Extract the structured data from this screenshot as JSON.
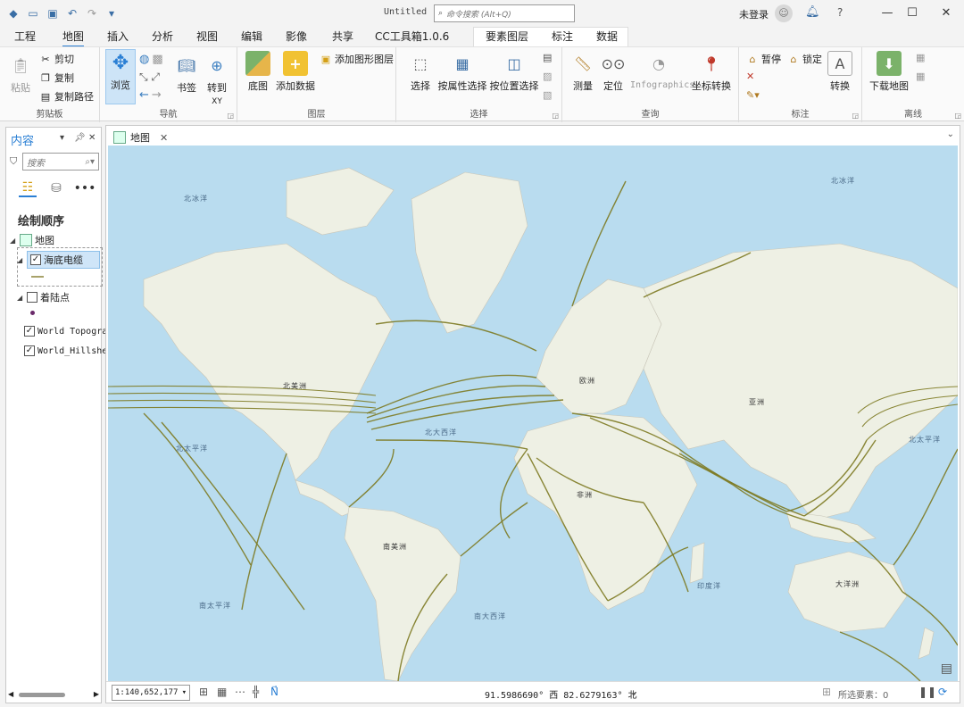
{
  "window": {
    "title": "Untitled",
    "command_search_placeholder": "命令搜索 (Alt+Q)",
    "login_label": "未登录",
    "help": "?",
    "minimize": "—",
    "maximize": "☐",
    "close": "✕"
  },
  "tabs": [
    {
      "label": "工程"
    },
    {
      "label": "地图"
    },
    {
      "label": "插入"
    },
    {
      "label": "分析"
    },
    {
      "label": "视图"
    },
    {
      "label": "编辑"
    },
    {
      "label": "影像"
    },
    {
      "label": "共享"
    },
    {
      "label": "CC工具箱1.0.6"
    },
    {
      "label": "要素图层"
    },
    {
      "label": "标注"
    },
    {
      "label": "数据"
    }
  ],
  "ribbon": {
    "clipboard": {
      "paste": "粘贴",
      "cut": "剪切",
      "copy": "复制",
      "copy_path": "复制路径",
      "group": "剪贴板"
    },
    "navigate": {
      "explore": "浏览",
      "bookmarks": "书签",
      "goto_xy": "转到",
      "goto_xy_sub": "XY",
      "group": "导航"
    },
    "layer": {
      "basemap": "底图",
      "add_data": "添加数据",
      "add_graphics": "添加图形图层",
      "group": "图层"
    },
    "selection": {
      "select": "选择",
      "by_attr": "按属性选择",
      "by_loc": "按位置选择",
      "group": "选择"
    },
    "inquiry": {
      "measure": "测量",
      "locate": "定位",
      "infographics": "Infographics",
      "convert_coords": "坐标转换",
      "group": "查询"
    },
    "labeling": {
      "pause": "暂停",
      "lock": "锁定",
      "convert": "转换",
      "group": "标注"
    },
    "offline": {
      "download_map": "下载地图",
      "group": "离线"
    }
  },
  "contents": {
    "title": "内容",
    "search_placeholder": "搜索",
    "drawing_order": "绘制顺序",
    "map_name": "地图",
    "layers": [
      {
        "name": "海底电缆",
        "checked": true,
        "symbol_color": "#a8a26a"
      },
      {
        "name": "着陆点",
        "checked": false,
        "symbol_color": "#6a2a6a"
      },
      {
        "name": "World Topogra",
        "checked": true
      },
      {
        "name": "World_Hillshe",
        "checked": true
      }
    ]
  },
  "map_view": {
    "tab_label": "地图",
    "labels": {
      "north_america": "北美洲",
      "south_america": "南美洲",
      "europe": "欧洲",
      "asia": "亚洲",
      "africa": "非洲",
      "oceania": "大洋洲",
      "arctic_left": "北冰洋",
      "arctic_right": "北冰洋",
      "n_pacific_left": "北太平洋",
      "n_pacific_right": "北太平洋",
      "n_atlantic": "北大西洋",
      "s_atlantic": "南大西洋",
      "s_pacific": "南太平洋",
      "indian": "印度洋"
    },
    "cable_color": "#7d7a22",
    "ocean_color": "#b9dcef",
    "land_color": "#eef0e4"
  },
  "status": {
    "scale": "1:140,652,177",
    "coordinates": "91.5986690° 西  82.6279163° 北",
    "selected_features": "所选要素：0"
  }
}
